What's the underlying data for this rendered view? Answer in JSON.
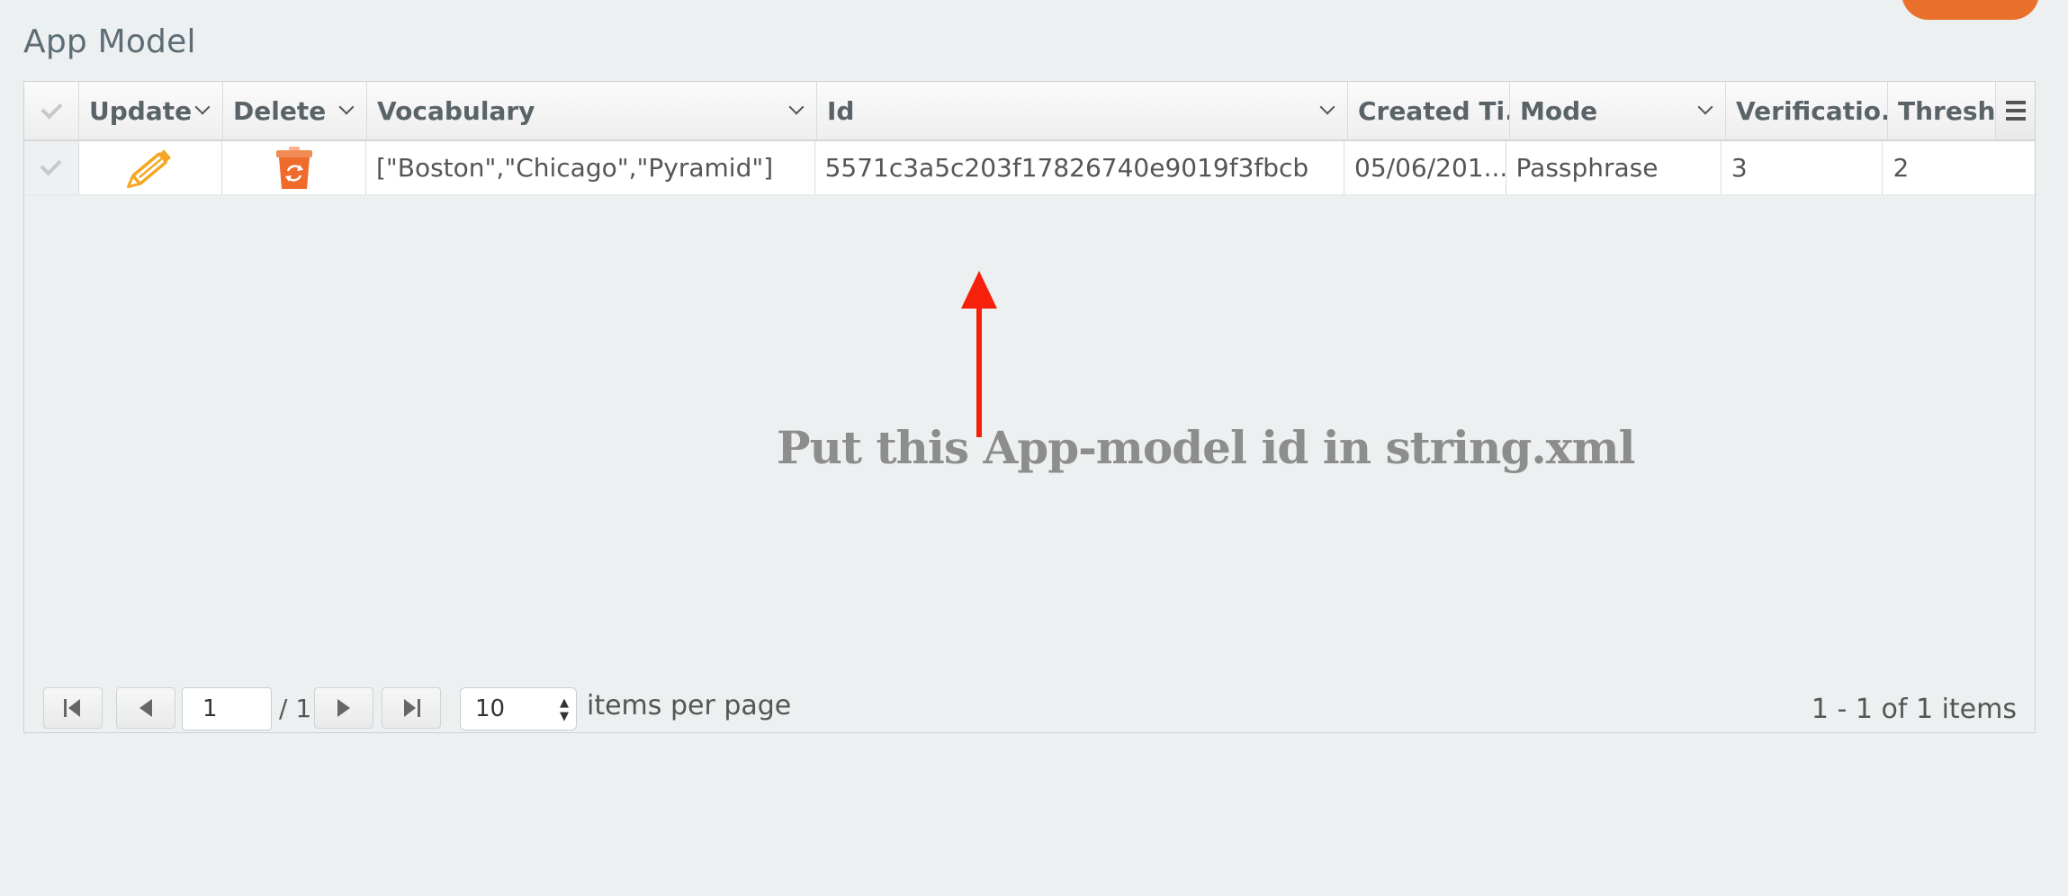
{
  "section_title": "App Model",
  "columns": [
    {
      "label": "",
      "key": "select"
    },
    {
      "label": "Update",
      "key": "update"
    },
    {
      "label": "Delete",
      "key": "delete"
    },
    {
      "label": "Vocabulary",
      "key": "vocabulary"
    },
    {
      "label": "Id",
      "key": "id"
    },
    {
      "label": "Created Ti...",
      "key": "created"
    },
    {
      "label": "Mode",
      "key": "mode"
    },
    {
      "label": "Verificatio...",
      "key": "verification"
    },
    {
      "label": "Thresho",
      "key": "threshold"
    }
  ],
  "rows": [
    {
      "update_icon": "pencil-icon",
      "delete_icon": "recycle-bin-icon",
      "vocabulary": "[\"Boston\",\"Chicago\",\"Pyramid\"]",
      "id": "5571c3a5c203f17826740e9019f3fbcb",
      "created": "05/06/201...",
      "mode": "Passphrase",
      "verification": "3",
      "threshold": "2"
    }
  ],
  "annotation": {
    "text": "Put this App-model id in string.xml",
    "color": "#f5210c"
  },
  "pager": {
    "page_value": "1",
    "total_pages": "/ 1",
    "page_size": "10",
    "per_page_label": "items per page",
    "items_info": "1 - 1 of 1 items"
  },
  "colors": {
    "accent": "#e8702a",
    "pencil": "#f5a623",
    "bin": "#ef6a2b"
  }
}
